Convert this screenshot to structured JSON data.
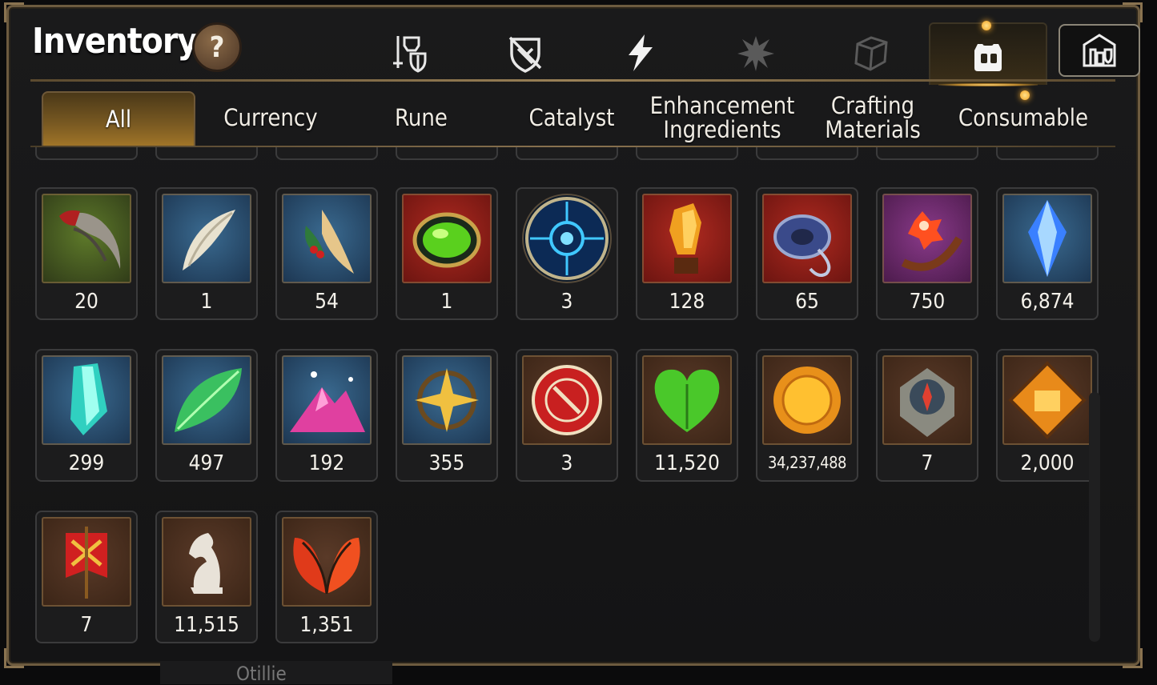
{
  "title": "Inventory",
  "help_label": "?",
  "category_icons": [
    {
      "name": "gear-icon",
      "active": false
    },
    {
      "name": "broken-shield-icon",
      "active": false
    },
    {
      "name": "lightning-icon",
      "active": false
    },
    {
      "name": "splatter-icon",
      "active": false
    },
    {
      "name": "crate-icon",
      "active": false
    },
    {
      "name": "bag-icon",
      "active": true
    },
    {
      "name": "castle-icon",
      "active": false
    }
  ],
  "tabs": [
    {
      "label": "All",
      "active": true
    },
    {
      "label": "Currency",
      "active": false
    },
    {
      "label": "Rune",
      "active": false
    },
    {
      "label": "Catalyst",
      "active": false
    },
    {
      "label": "Enhancement Ingredients",
      "active": false
    },
    {
      "label": "Crafting Materials",
      "active": false
    },
    {
      "label": "Consumable",
      "active": false
    }
  ],
  "items": [
    {
      "icon": "claw-icon",
      "count": "20"
    },
    {
      "icon": "fang-icon",
      "count": "1"
    },
    {
      "icon": "herb-root-icon",
      "count": "54"
    },
    {
      "icon": "green-orb-icon",
      "count": "1"
    },
    {
      "icon": "blue-rune-disc-icon",
      "count": "3"
    },
    {
      "icon": "amber-crystal-icon",
      "count": "128"
    },
    {
      "icon": "ring-pendant-icon",
      "count": "65"
    },
    {
      "icon": "flower-ring-icon",
      "count": "750"
    },
    {
      "icon": "blue-gem-icon",
      "count": "6,874"
    },
    {
      "icon": "teal-crystal-icon",
      "count": "299"
    },
    {
      "icon": "green-leaf-icon",
      "count": "497"
    },
    {
      "icon": "pink-mountain-icon",
      "count": "192"
    },
    {
      "icon": "star-amulet-icon",
      "count": "355"
    },
    {
      "icon": "red-seal-icon",
      "count": "3"
    },
    {
      "icon": "green-heart-icon",
      "count": "11,520"
    },
    {
      "icon": "gold-coin-icon",
      "count": "34,237,488"
    },
    {
      "icon": "stone-compass-icon",
      "count": "7"
    },
    {
      "icon": "fist-emblem-icon",
      "count": "2,000"
    },
    {
      "icon": "war-banner-icon",
      "count": "7"
    },
    {
      "icon": "knight-piece-icon",
      "count": "11,515"
    },
    {
      "icon": "red-leaves-icon",
      "count": "1,351"
    }
  ],
  "footer_text": "Otillie"
}
